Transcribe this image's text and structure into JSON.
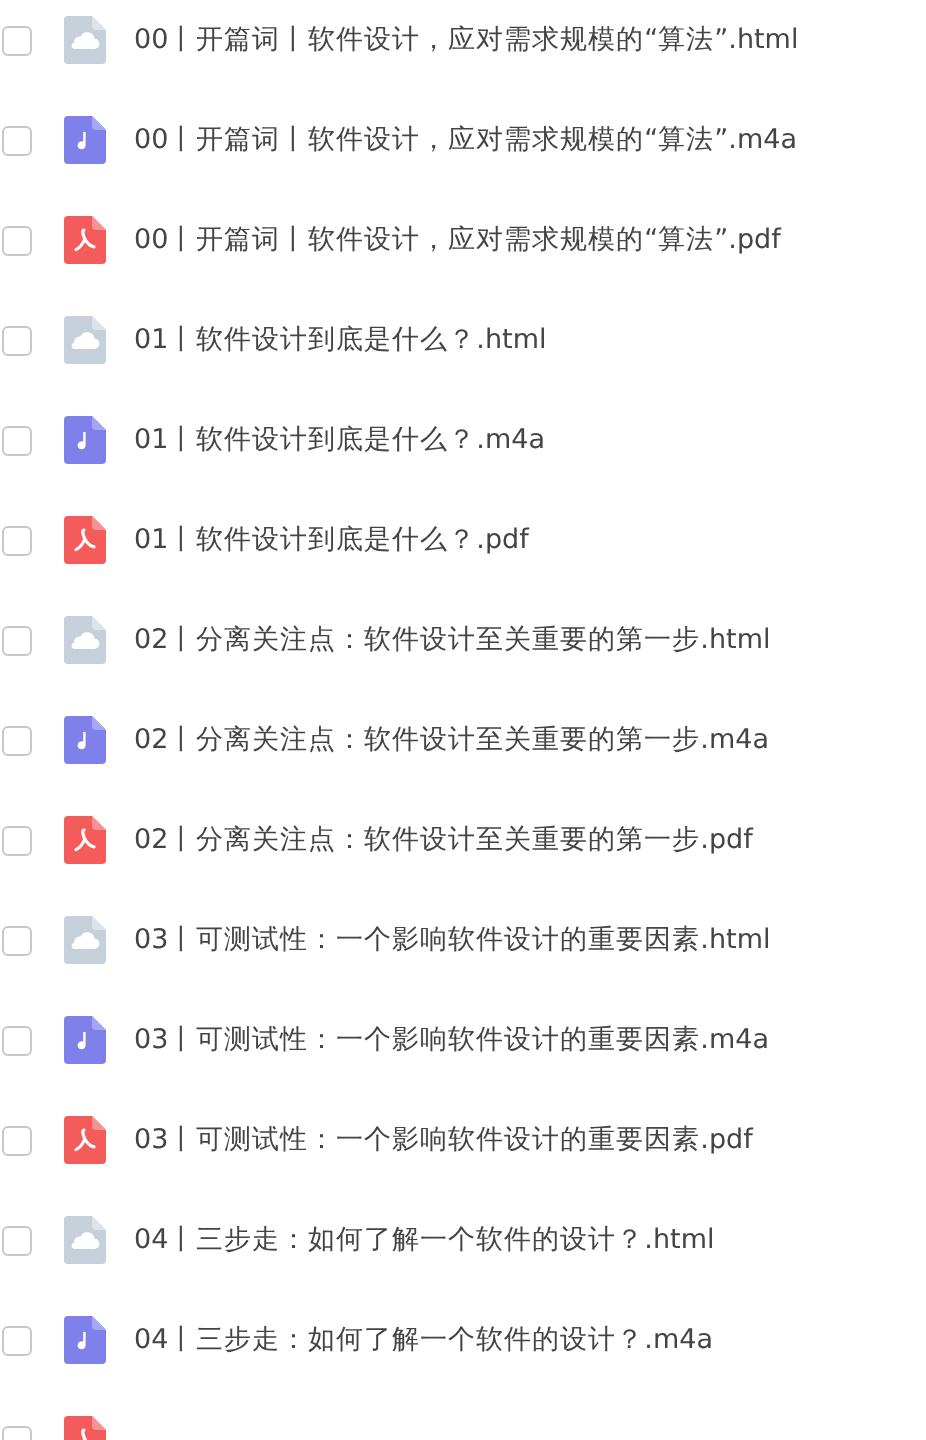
{
  "files": [
    {
      "name": "00丨开篇词丨软件设计，应对需求规模的“算法”.html",
      "kind": "html",
      "checked": false
    },
    {
      "name": "00丨开篇词丨软件设计，应对需求规模的“算法”.m4a",
      "kind": "audio",
      "checked": false
    },
    {
      "name": "00丨开篇词丨软件设计，应对需求规模的“算法”.pdf",
      "kind": "pdf",
      "checked": false
    },
    {
      "name": "01丨软件设计到底是什么？.html",
      "kind": "html",
      "checked": false
    },
    {
      "name": "01丨软件设计到底是什么？.m4a",
      "kind": "audio",
      "checked": false
    },
    {
      "name": "01丨软件设计到底是什么？.pdf",
      "kind": "pdf",
      "checked": false
    },
    {
      "name": "02丨分离关注点：软件设计至关重要的第一步.html",
      "kind": "html",
      "checked": false
    },
    {
      "name": "02丨分离关注点：软件设计至关重要的第一步.m4a",
      "kind": "audio",
      "checked": false
    },
    {
      "name": "02丨分离关注点：软件设计至关重要的第一步.pdf",
      "kind": "pdf",
      "checked": false
    },
    {
      "name": "03丨可测试性：一个影响软件设计的重要因素.html",
      "kind": "html",
      "checked": false
    },
    {
      "name": "03丨可测试性：一个影响软件设计的重要因素.m4a",
      "kind": "audio",
      "checked": false
    },
    {
      "name": "03丨可测试性：一个影响软件设计的重要因素.pdf",
      "kind": "pdf",
      "checked": false
    },
    {
      "name": "04丨三步走：如何了解一个软件的设计？.html",
      "kind": "html",
      "checked": false
    },
    {
      "name": "04丨三步走：如何了解一个软件的设计？.m4a",
      "kind": "audio",
      "checked": false
    },
    {
      "kind": "pdf",
      "checked": false
    }
  ]
}
